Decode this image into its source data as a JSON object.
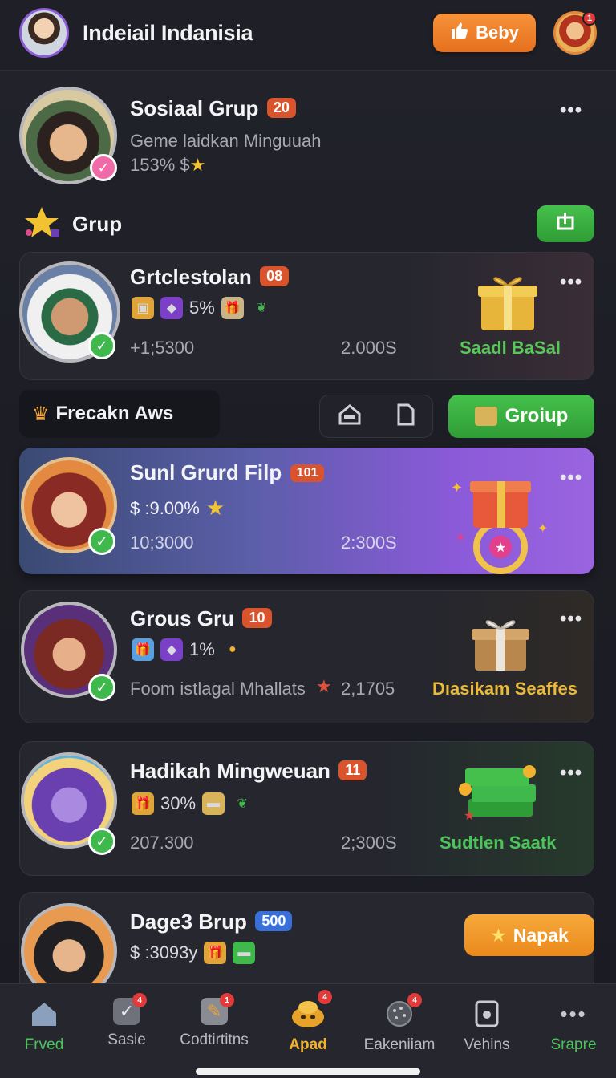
{
  "header": {
    "title": "Indeiail Indanisia",
    "action_label": "Beby",
    "notif_count": "1"
  },
  "profile": {
    "name": "Sosiaal Grup",
    "badge": "20",
    "subtitle": "Geme laidkan Minguuah",
    "stat": "153% $"
  },
  "section": {
    "title": "Grup"
  },
  "card1": {
    "name": "Grtclestolan",
    "badge": "08",
    "percent": "5%",
    "left_stat": "+1;5300",
    "right_stat": "2.000S",
    "promo": "Saadl BaSal"
  },
  "filter": {
    "label": "Frecakn Aws",
    "group_label": "Groiup"
  },
  "card2": {
    "name": "Sunl Grurd Filp",
    "badge": "101",
    "amount": "$ :9.00%",
    "left_stat": "10;3000",
    "right_stat": "2:300S"
  },
  "card3": {
    "name": "Grous Gru",
    "badge": "10",
    "percent": "1%",
    "desc": "Foom istlagal Mhallats",
    "stat": "2,1705",
    "promo": "Dıasikam Seaffes"
  },
  "card4": {
    "name": "Hadikah Mingweuan",
    "badge": "11",
    "percent": "30%",
    "left_stat": "207.300",
    "right_stat": "2;300S",
    "promo": "Sudtlen Saatk"
  },
  "card5": {
    "name": "Dage3 Brup",
    "badge": "500",
    "amount": "$ :3093y",
    "button": "Napak"
  },
  "nav": {
    "items": [
      {
        "label": "Frved",
        "badge": ""
      },
      {
        "label": "Sasie",
        "badge": "4"
      },
      {
        "label": "Codtirtitns",
        "badge": "1"
      },
      {
        "label": "Apad",
        "badge": "4"
      },
      {
        "label": "Eakeniiam",
        "badge": "4"
      },
      {
        "label": "Vehins",
        "badge": ""
      },
      {
        "label": "Srapre",
        "badge": ""
      }
    ]
  },
  "colors": {
    "accent_orange": "#e5701d",
    "accent_green": "#3fb94b",
    "badge_red": "#d9532c",
    "promo_gold": "#e8b93a",
    "promo_green": "#4cc45a",
    "purple_card": "#8a5ad8"
  }
}
